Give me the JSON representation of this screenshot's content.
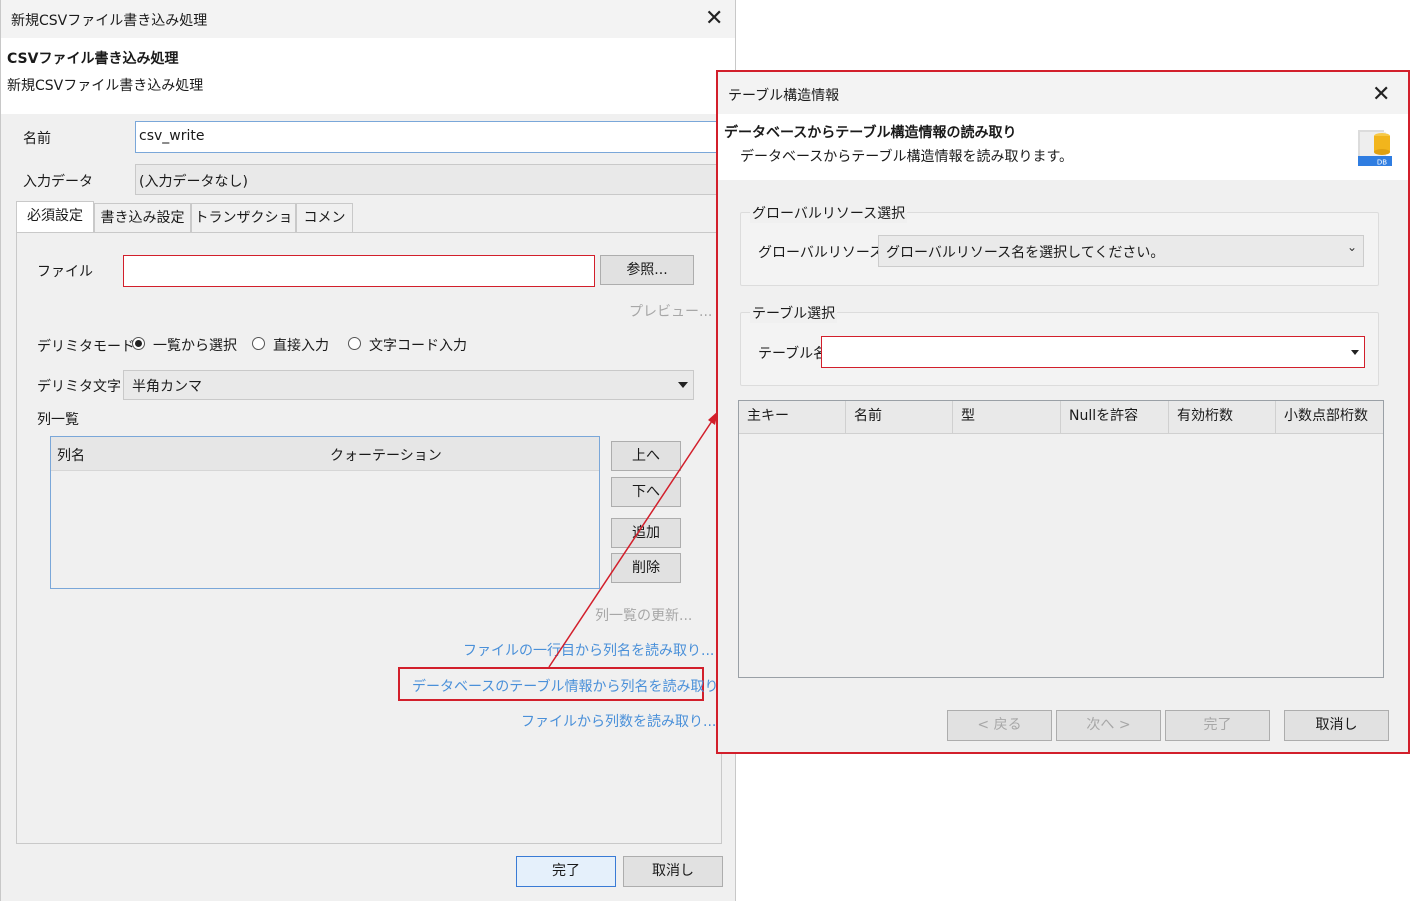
{
  "left_dialog": {
    "title": "新規CSVファイル書き込み処理",
    "header_title": "CSVファイル書き込み処理",
    "header_subtitle": "新規CSVファイル書き込み処理",
    "name_label": "名前",
    "name_value": "csv_write",
    "input_data_label": "入力データ",
    "input_data_value": "(入力データなし)",
    "tabs": [
      "必須設定",
      "書き込み設定",
      "トランザクション",
      "コメント"
    ],
    "file_label": "ファイル",
    "file_value": "",
    "browse_button": "参照...",
    "preview_link": "プレビュー...",
    "delimiter_mode_label": "デリミタモード",
    "delimiter_modes": [
      "一覧から選択",
      "直接入力",
      "文字コード入力"
    ],
    "delimiter_mode_selected": "一覧から選択",
    "delimiter_char_label": "デリミタ文字",
    "delimiter_char_value": "半角カンマ",
    "column_list_label": "列一覧",
    "column_headers": [
      "列名",
      "クォーテーション"
    ],
    "up_button": "上へ",
    "down_button": "下へ",
    "add_button": "追加",
    "delete_button": "削除",
    "update_list_link": "列一覧の更新...",
    "read_first_row_link": "ファイルの一行目から列名を読み取り...",
    "read_db_table_link": "データベースのテーブル情報から列名を読み取り...",
    "read_column_count_link": "ファイルから列数を読み取り...",
    "finish_button": "完了",
    "cancel_button": "取消し"
  },
  "right_dialog": {
    "title": "テーブル構造情報",
    "header_title": "データベースからテーブル構造情報の読み取り",
    "header_subtitle": "データベースからテーブル構造情報を読み取ります。",
    "header_icon": "database-icon",
    "global_group_title": "グローバルリソース選択",
    "global_resource_label": "グローバルリソース名",
    "global_resource_placeholder": "グローバルリソース名を選択してください。",
    "table_group_title": "テーブル選択",
    "table_name_label": "テーブル名",
    "table_name_value": "",
    "columns": [
      "主キー",
      "名前",
      "型",
      "Nullを許容",
      "有効桁数",
      "小数点部桁数"
    ],
    "back_button": "< 戻る",
    "next_button": "次へ >",
    "finish_button": "完了",
    "cancel_button": "取消し"
  },
  "colors": {
    "highlight": "#d21f2b",
    "link": "#4a90d9",
    "disabled_link": "#a7a7a7"
  }
}
